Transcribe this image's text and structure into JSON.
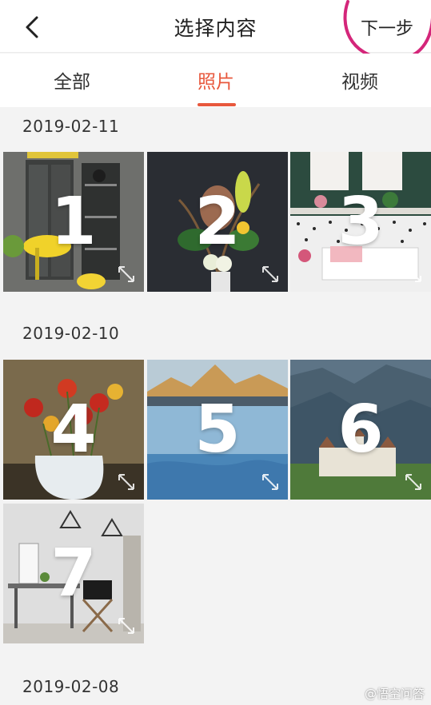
{
  "header": {
    "title": "选择内容",
    "next_label": "下一步"
  },
  "tabs": [
    {
      "label": "全部",
      "active": false
    },
    {
      "label": "照片",
      "active": true
    },
    {
      "label": "视频",
      "active": false
    }
  ],
  "sections": [
    {
      "date": "2019-02-11",
      "photos": [
        {
          "number": "1",
          "subject": "gray metal cabinet with yellow chair"
        },
        {
          "number": "2",
          "subject": "flower arrangement on dark background"
        },
        {
          "number": "3",
          "subject": "white bed with polka dot wall"
        }
      ]
    },
    {
      "date": "2019-02-10",
      "photos": [
        {
          "number": "4",
          "subject": "red flowers in white pitcher"
        },
        {
          "number": "5",
          "subject": "mountain lake"
        },
        {
          "number": "6",
          "subject": "castle in valley"
        }
      ]
    },
    {
      "date": "",
      "photos": [
        {
          "number": "7",
          "subject": "desk with director chair"
        }
      ]
    },
    {
      "date": "2019-02-08",
      "photos": []
    }
  ],
  "watermark": "@悟空问答",
  "colors": {
    "accent": "#e8583d",
    "annotation": "#d4267a"
  }
}
